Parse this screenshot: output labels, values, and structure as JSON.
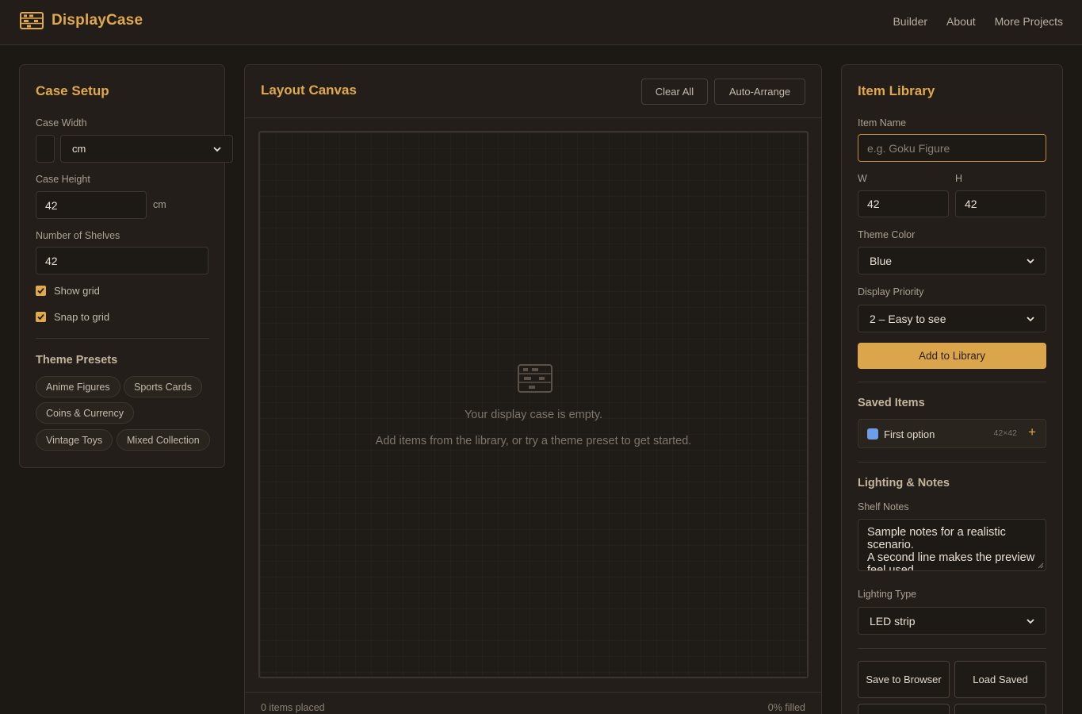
{
  "header": {
    "brand": "DisplayCase",
    "nav": [
      "Builder",
      "About",
      "More Projects"
    ]
  },
  "case_setup": {
    "title": "Case Setup",
    "width_label": "Case Width",
    "width_value": "",
    "width_unit_select": "cm",
    "height_label": "Case Height",
    "height_value": "42",
    "height_unit": "cm",
    "shelves_label": "Number of Shelves",
    "shelves_value": "42",
    "show_grid": {
      "label": "Show grid",
      "checked": true
    },
    "snap_grid": {
      "label": "Snap to grid",
      "checked": true
    },
    "presets_title": "Theme Presets",
    "presets": [
      "Anime Figures",
      "Sports Cards",
      "Coins & Currency",
      "Vintage Toys",
      "Mixed Collection"
    ]
  },
  "canvas": {
    "title": "Layout Canvas",
    "clear_label": "Clear All",
    "arrange_label": "Auto-Arrange",
    "empty_title": "Your display case is empty.",
    "empty_sub": "Add items from the library, or try a theme preset to get started.",
    "placed": "0 items placed",
    "filled": "0% filled"
  },
  "library": {
    "title": "Item Library",
    "name_label": "Item Name",
    "name_placeholder": "e.g. Goku Figure",
    "w_label": "W",
    "h_label": "H",
    "w_value": "42",
    "h_value": "42",
    "color_label": "Theme Color",
    "color_value": "Blue",
    "priority_label": "Display Priority",
    "priority_value": "2 – Easy to see",
    "add_label": "Add to Library",
    "saved_title": "Saved Items",
    "saved_items": [
      {
        "name": "First option",
        "size": "42×42",
        "color": "#6f9ee8"
      }
    ],
    "lighting_title": "Lighting & Notes",
    "notes_label": "Shelf Notes",
    "notes_lines": [
      "Sample notes for a realistic",
      "scenario.",
      "A second line makes the preview",
      "feel used."
    ],
    "lighting_label": "Lighting Type",
    "lighting_value": "LED strip",
    "save_label": "Save to Browser",
    "load_label": "Load Saved"
  },
  "colors": {
    "accent": "#e0a94c",
    "background": "#1c1814",
    "panel": "#231e19"
  }
}
